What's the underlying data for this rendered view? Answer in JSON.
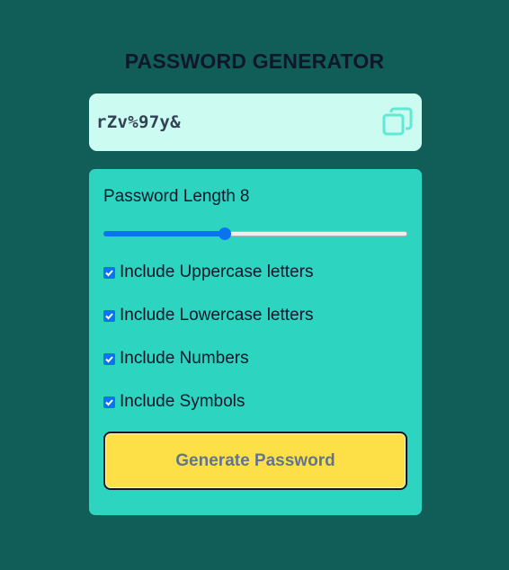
{
  "app": {
    "title": "PASSWORD GENERATOR"
  },
  "output": {
    "password": "rZv%97y&",
    "copy_icon": "copy-icon"
  },
  "settings": {
    "length_label": "Password Length",
    "length_value": "8",
    "slider_fraction": 0.4,
    "options": [
      {
        "label": "Include Uppercase letters",
        "checked": true
      },
      {
        "label": "Include Lowercase letters",
        "checked": true
      },
      {
        "label": "Include Numbers",
        "checked": true
      },
      {
        "label": "Include Symbols",
        "checked": true
      }
    ],
    "generate_label": "Generate Password"
  },
  "colors": {
    "background": "#115e59",
    "output_bg": "#ccfbf1",
    "panel_bg": "#2dd4bf",
    "button_bg": "#fde047",
    "accent": "#0a74f0",
    "copy_icon": "#5eead4"
  }
}
